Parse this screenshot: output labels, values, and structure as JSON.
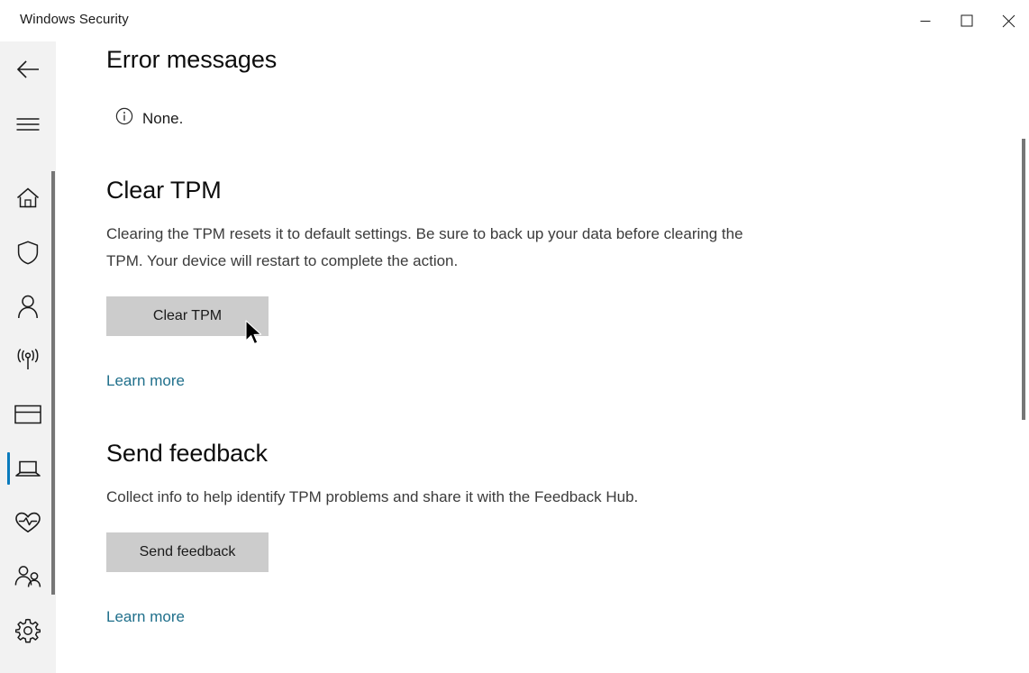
{
  "window": {
    "title": "Windows Security",
    "controls": [
      {
        "name": "minimize",
        "label": "Minimize"
      },
      {
        "name": "maximize",
        "label": "Maximize"
      },
      {
        "name": "close",
        "label": "Close"
      }
    ]
  },
  "rail": {
    "back_label": "Back",
    "menu_label": "Open navigation menu",
    "items": [
      {
        "icon": "home-icon",
        "label": "Home",
        "selected": false
      },
      {
        "icon": "shield-icon",
        "label": "Virus & threat protection",
        "selected": false
      },
      {
        "icon": "person-icon",
        "label": "Account protection",
        "selected": false
      },
      {
        "icon": "firewall-signal-icon",
        "label": "Firewall & network protection",
        "selected": false
      },
      {
        "icon": "app-browser-icon",
        "label": "App & browser control",
        "selected": false
      },
      {
        "icon": "laptop-icon",
        "label": "Device security",
        "selected": true
      },
      {
        "icon": "heart-pulse-icon",
        "label": "Device performance & health",
        "selected": false
      },
      {
        "icon": "family-icon",
        "label": "Family options",
        "selected": false
      },
      {
        "icon": "gear-icon",
        "label": "Settings",
        "selected": false
      }
    ]
  },
  "main": {
    "error_messages": {
      "heading": "Error messages",
      "status_icon": "info-icon",
      "status_text": "None."
    },
    "clear_tpm": {
      "heading": "Clear TPM",
      "description": "Clearing the TPM resets it to default settings. Be sure to back up your data before clearing the TPM. Your device will restart to complete the action.",
      "button_label": "Clear TPM",
      "learn_more_label": "Learn more"
    },
    "send_feedback": {
      "heading": "Send feedback",
      "description": "Collect info to help identify TPM problems and share it with the Feedback Hub.",
      "button_label": "Send feedback",
      "learn_more_label": "Learn more"
    }
  },
  "theme": {
    "accent": "#0a7bbd",
    "link": "#1f6f8b",
    "button_face": "#cccccc",
    "rail_background": "#f2f2f2",
    "content_background": "#ffffff",
    "scrollbar_thumb": "#767676"
  }
}
